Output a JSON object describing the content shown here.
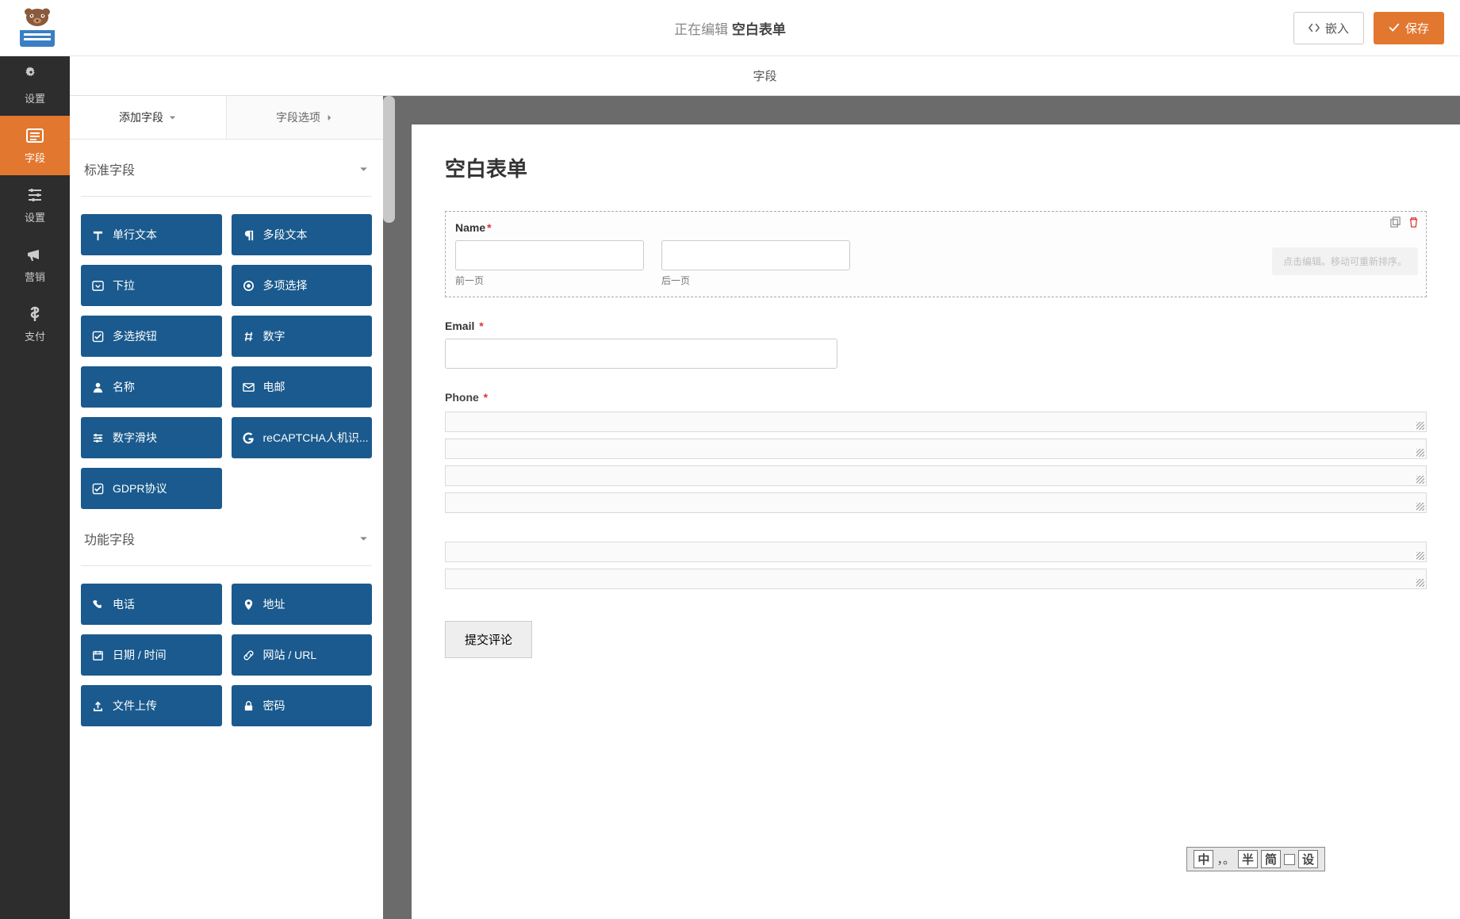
{
  "header": {
    "editing_prefix": "正在编辑",
    "form_name": "空白表单",
    "embed_label": "嵌入",
    "save_label": "保存"
  },
  "subheader": {
    "title": "字段"
  },
  "sidebar": {
    "items": [
      {
        "label": "设置",
        "icon": "gear"
      },
      {
        "label": "字段",
        "icon": "form"
      },
      {
        "label": "设置",
        "icon": "sliders"
      },
      {
        "label": "营销",
        "icon": "bullhorn"
      },
      {
        "label": "支付",
        "icon": "dollar"
      }
    ],
    "active_index": 1
  },
  "left_panel": {
    "tabs": {
      "add": "添加字段",
      "options": "字段选项"
    },
    "standard_header": "标准字段",
    "fancy_header": "功能字段",
    "standard": [
      {
        "label": "单行文本",
        "icon": "text"
      },
      {
        "label": "多段文本",
        "icon": "paragraph"
      },
      {
        "label": "下拉",
        "icon": "caret"
      },
      {
        "label": "多项选择",
        "icon": "radio"
      },
      {
        "label": "多选按钮",
        "icon": "check"
      },
      {
        "label": "数字",
        "icon": "hash"
      },
      {
        "label": "名称",
        "icon": "user"
      },
      {
        "label": "电邮",
        "icon": "mail"
      },
      {
        "label": "数字滑块",
        "icon": "sliders"
      },
      {
        "label": "reCAPTCHA人机识...",
        "icon": "google"
      },
      {
        "label": "GDPR协议",
        "icon": "check"
      }
    ],
    "fancy": [
      {
        "label": "电话",
        "icon": "phone"
      },
      {
        "label": "地址",
        "icon": "pin"
      },
      {
        "label": "日期 / 时间",
        "icon": "calendar"
      },
      {
        "label": "网站 / URL",
        "icon": "link"
      },
      {
        "label": "文件上传",
        "icon": "upload"
      },
      {
        "label": "密码",
        "icon": "lock"
      }
    ]
  },
  "preview": {
    "form_title": "空白表单",
    "hint": "点击编辑。移动可重新排序。",
    "name_field": {
      "label": "Name",
      "first_sub": "前一页",
      "last_sub": "后一页"
    },
    "email_field": {
      "label": "Email"
    },
    "phone_field": {
      "label": "Phone"
    },
    "submit_label": "提交评论",
    "ime": {
      "lang": "中",
      "punct": "，。",
      "width": "半",
      "script": "简",
      "set": "设"
    }
  }
}
